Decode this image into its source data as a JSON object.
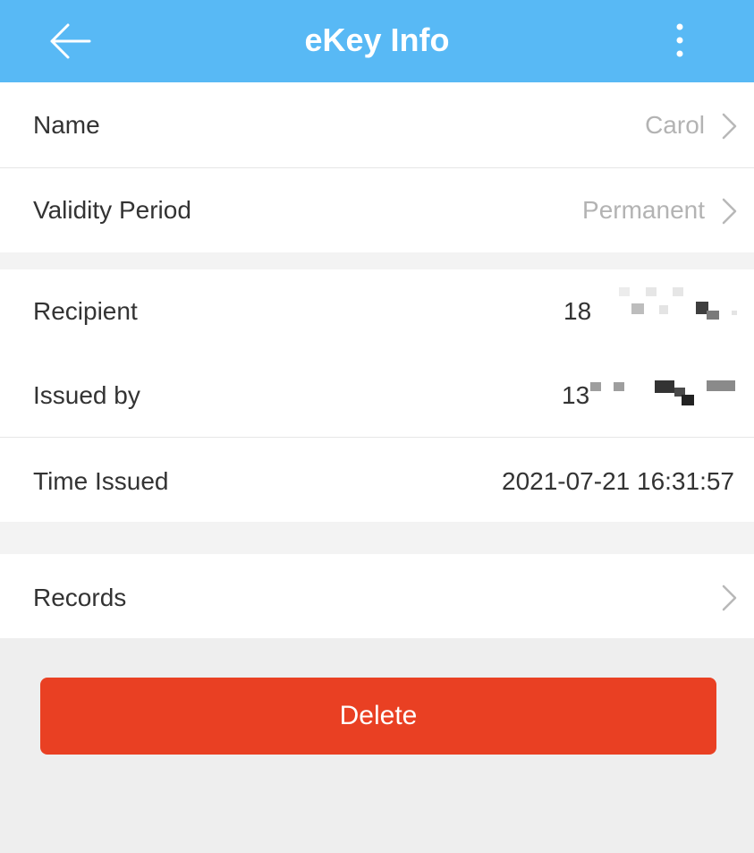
{
  "header": {
    "title": "eKey Info",
    "back_icon": "arrow-left-icon",
    "more_icon": "kebab-menu-icon",
    "bg_color": "#58b9f5"
  },
  "rows": {
    "name": {
      "label": "Name",
      "value": "Carol"
    },
    "validity": {
      "label": "Validity Period",
      "value": "Permanent"
    },
    "recipient": {
      "label": "Recipient",
      "value": "18"
    },
    "issued_by": {
      "label": "Issued by",
      "value": "13"
    },
    "time_issued": {
      "label": "Time Issued",
      "value": "2021-07-21 16:31:57"
    },
    "records": {
      "label": "Records"
    }
  },
  "actions": {
    "delete_label": "Delete",
    "delete_color": "#e94023"
  }
}
